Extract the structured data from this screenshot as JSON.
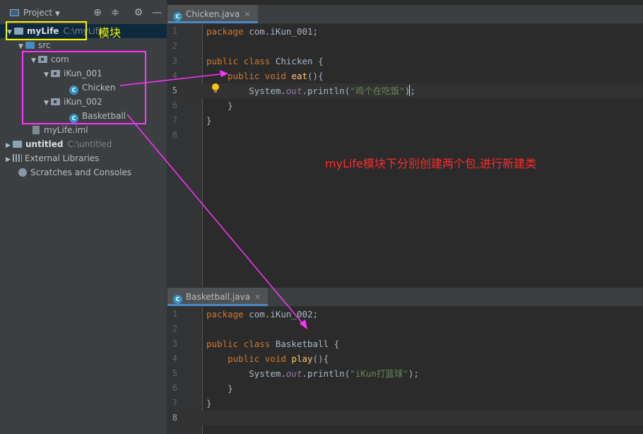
{
  "project_panel": {
    "title": "Project",
    "tree": {
      "mylife": {
        "label": "myLife",
        "path": "C:\\myLife"
      },
      "src": {
        "label": "src"
      },
      "com": {
        "label": "com"
      },
      "pkg1": {
        "label": "iKun_001"
      },
      "chicken": {
        "label": "Chicken"
      },
      "pkg2": {
        "label": "iKun_002"
      },
      "basketball": {
        "label": "Basketball"
      },
      "iml": {
        "label": "myLife.iml"
      },
      "untitled": {
        "label": "untitled",
        "path": "C:\\untitled"
      },
      "external": {
        "label": "External Libraries"
      },
      "scratches": {
        "label": "Scratches and Consoles"
      }
    }
  },
  "editor_top": {
    "tab_label": "Chicken.java",
    "line_numbers": [
      "1",
      "2",
      "3",
      "4",
      "5",
      "6",
      "7",
      "8"
    ],
    "code": {
      "l1_kw": "package",
      "l1_rest": " com.iKun_001;",
      "l3_kw1": "public",
      "l3_kw2": "class",
      "l3_name": "Chicken",
      "l3_brace": " {",
      "l4_kw1": "public",
      "l4_kw2": "void",
      "l4_fn": "eat",
      "l4_rest": "(){",
      "l5_a": "System.",
      "l5_field": "out",
      "l5_b": ".println(",
      "l5_str": "\"鸡个在吃饭\"",
      "l5_c": ");",
      "l6": "}",
      "l7": "}"
    }
  },
  "editor_bottom": {
    "tab_label": "Basketball.java",
    "line_numbers": [
      "1",
      "2",
      "3",
      "4",
      "5",
      "6",
      "7",
      "8"
    ],
    "code": {
      "l1_kw": "package",
      "l1_rest": " com.iKun_002;",
      "l3_kw1": "public",
      "l3_kw2": "class",
      "l3_name": "Basketball",
      "l3_brace": " {",
      "l4_kw1": "public",
      "l4_kw2": "void",
      "l4_fn": "play",
      "l4_rest": "(){",
      "l5_a": "System.",
      "l5_field": "out",
      "l5_b": ".println(",
      "l5_str": "\"iKun打篮球\"",
      "l5_c": ");",
      "l6": "}",
      "l7": "}"
    }
  },
  "annotations": {
    "module_label": "模块",
    "note": "myLife模块下分别创建两个包,进行新建类"
  },
  "colors": {
    "keyword": "#cc7832",
    "string": "#6a8759",
    "function": "#ffc66d",
    "annotation_magenta": "#ff33ff",
    "annotation_yellow": "#f7f700",
    "annotation_red": "#ff2b2b"
  }
}
